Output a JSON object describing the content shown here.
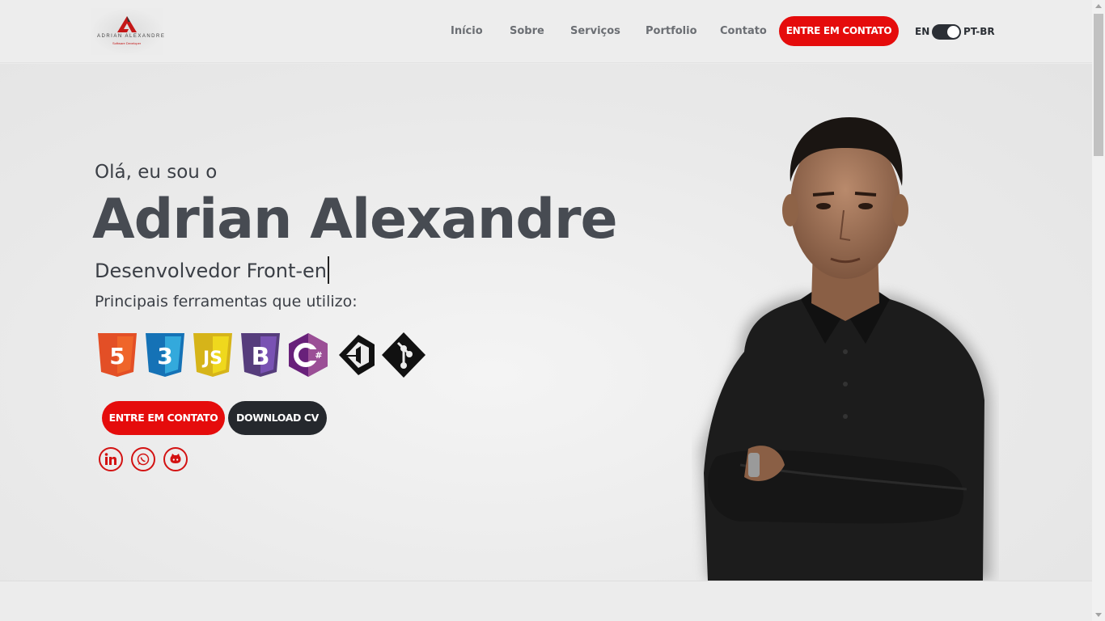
{
  "logo": {
    "name": "ADRIAN ALEXANDRE",
    "subtitle": "Software Developer"
  },
  "nav": {
    "items": [
      "Início",
      "Sobre",
      "Serviços",
      "Portfolio",
      "Contato"
    ],
    "cta_label": "ENTRE EM CONTATO",
    "lang_left": "EN",
    "lang_right": "PT-BR"
  },
  "hero": {
    "greeting": "Olá, eu sou o",
    "name": "Adrian Alexandre",
    "role": "Desenvolvedor Front-en",
    "tools_label": "Principais ferramentas que utilizo:",
    "tools": [
      "html5-icon",
      "css3-icon",
      "javascript-icon",
      "bootstrap-icon",
      "csharp-icon",
      "unity-icon",
      "git-icon"
    ],
    "contact_button": "ENTRE EM CONTATO",
    "cv_button": "DOWNLOAD CV",
    "social": [
      "linkedin-icon",
      "whatsapp-icon",
      "github-icon"
    ]
  },
  "colors": {
    "accent": "#e50c0c",
    "dark": "#25282d",
    "text": "#474b52"
  }
}
